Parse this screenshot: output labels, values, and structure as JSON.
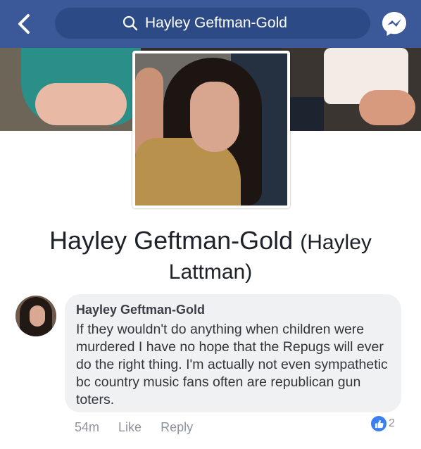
{
  "header": {
    "search_text": "Hayley Geftman-Gold",
    "bar_color": "#3b5998",
    "icons": [
      "back-arrow-icon",
      "search-icon",
      "messenger-icon"
    ]
  },
  "profile": {
    "name": "Hayley Geftman-Gold",
    "alternate_name": "(Hayley",
    "alternate_name_line2": "Lattman)"
  },
  "comment": {
    "author": "Hayley Geftman-Gold",
    "text": "If they wouldn't do anything when children were murdered I have no hope that the Repugs will ever do the right thing.  I'm actually not even sympathetic bc country music fans often are republican gun toters.",
    "time": "54m",
    "like_label": "Like",
    "reply_label": "Reply",
    "reaction_count": "2"
  }
}
